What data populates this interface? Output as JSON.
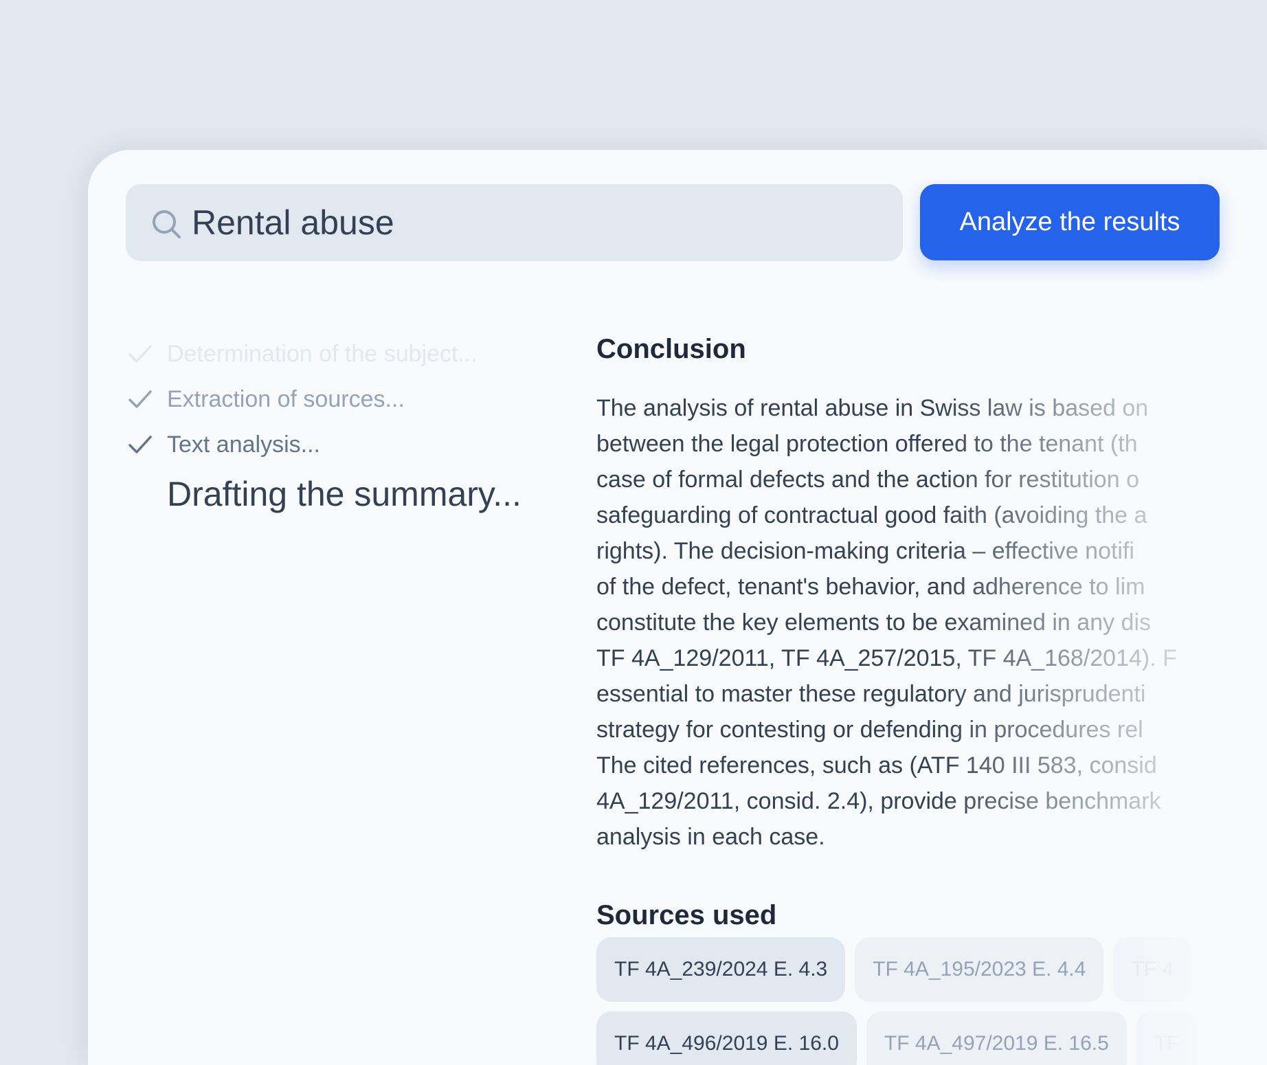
{
  "search": {
    "query": "Rental abuse",
    "icon": "search-icon"
  },
  "actions": {
    "analyze_label": "Analyze the results"
  },
  "steps": [
    {
      "label": "Determination of the subject...",
      "done": true
    },
    {
      "label": "Extraction of sources...",
      "done": true
    },
    {
      "label": "Text analysis...",
      "done": true
    }
  ],
  "current_step": "Drafting the summary...",
  "conclusion": {
    "title": "Conclusion",
    "lines": [
      "The analysis of rental abuse in Swiss law is based on",
      "between the legal protection offered to the tenant (th",
      "case of formal defects and the action for restitution o",
      "safeguarding of contractual good faith (avoiding the a",
      "rights). The decision-making criteria – effective notifi",
      "of the defect, tenant's behavior, and adherence to lim",
      "constitute the key elements to be examined in any dis",
      "TF 4A_129/2011, TF 4A_257/2015, TF 4A_168/2014). F",
      "essential to master these regulatory and jurisprudenti",
      "strategy for contesting or defending in procedures rel",
      "The cited references, such as (ATF 140 III 583, consid",
      "4A_129/2011, consid. 2.4), provide precise benchmark",
      "analysis in each case."
    ]
  },
  "sources": {
    "title": "Sources used",
    "row1": [
      "TF 4A_239/2024 E. 4.3",
      "TF 4A_195/2023 E. 4.4",
      "TF 4"
    ],
    "row2": [
      "TF 4A_496/2019 E. 16.0",
      "TF 4A_497/2019 E. 16.5",
      "TF"
    ]
  },
  "colors": {
    "accent": "#2563eb",
    "background": "#e2e8f0",
    "card": "#f8fafc"
  }
}
